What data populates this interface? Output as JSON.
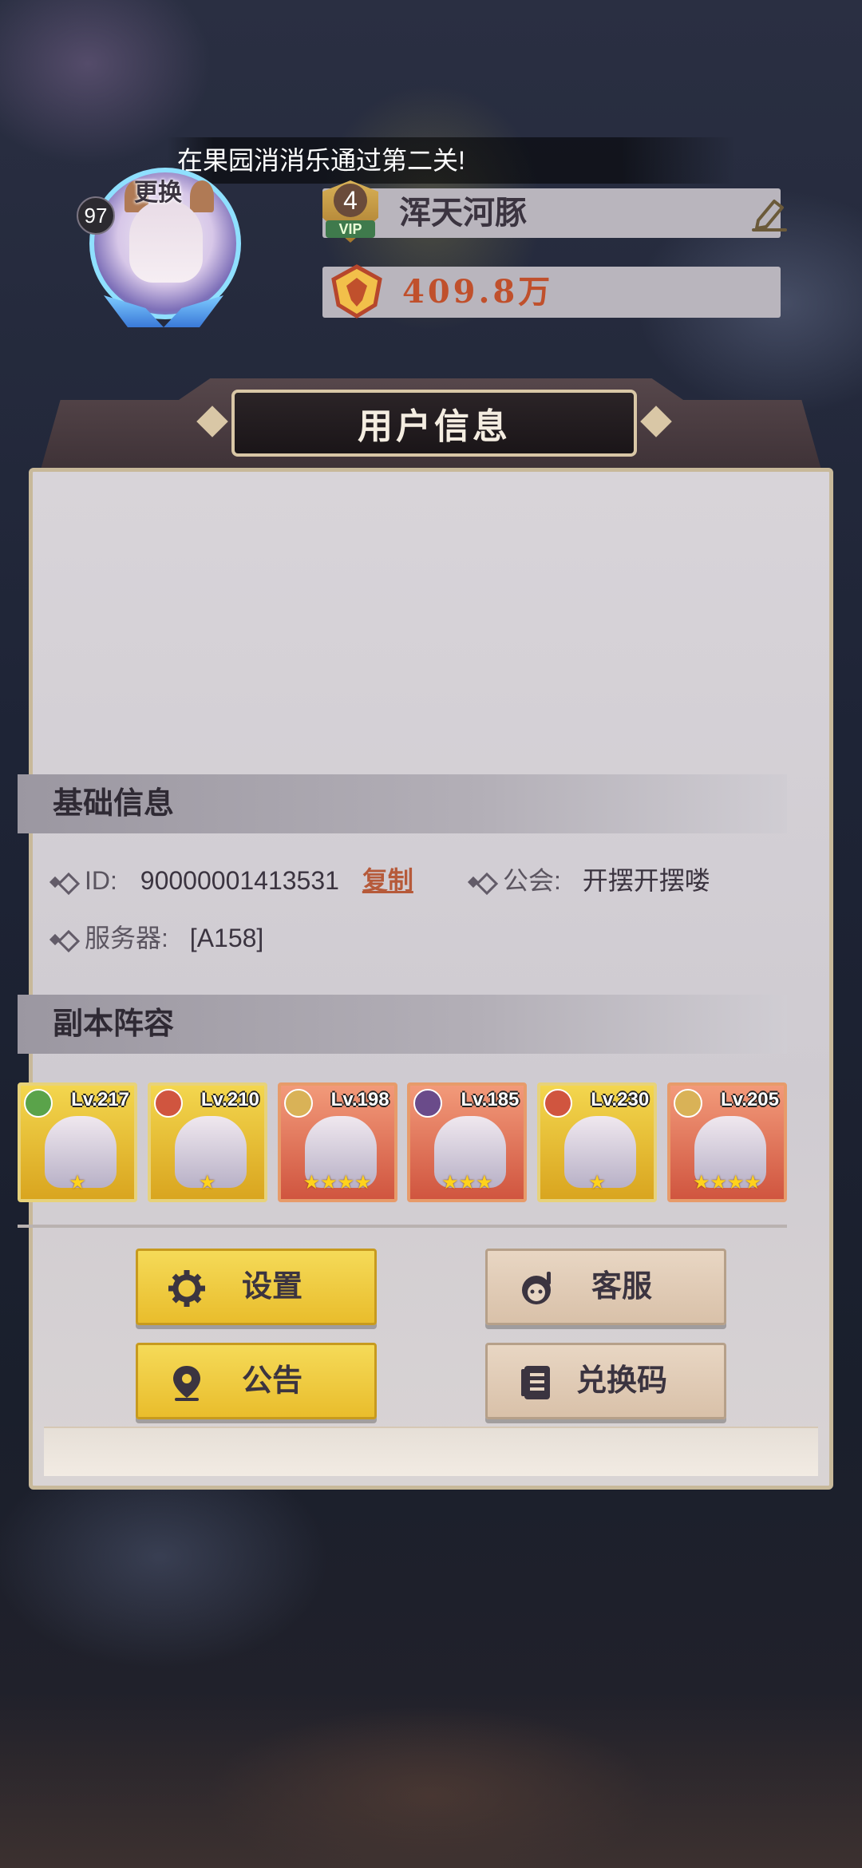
{
  "banner": {
    "text": "在果园消消乐通过第二关!"
  },
  "dialog": {
    "title": "用户信息",
    "avatar": {
      "level": "97",
      "change_label": "更换"
    },
    "vip": {
      "level": "4",
      "tag": "VIP"
    },
    "player_name": "浑天河豚",
    "power": "409.8万",
    "basic_info": {
      "section_title": "基础信息",
      "id_label": "ID:",
      "id_value": "90000001413531",
      "copy_label": "复制",
      "guild_label": "公会:",
      "guild_value": "开摆开摆喽",
      "server_label": "服务器:",
      "server_value": "[A158]"
    },
    "lineup": {
      "section_title": "副本阵容",
      "heroes": [
        {
          "level": "Lv.217",
          "stars": "★",
          "style": "gold",
          "element_color": "#5aa34a"
        },
        {
          "level": "Lv.210",
          "stars": "★",
          "style": "gold",
          "element_color": "#d0553f"
        },
        {
          "level": "Lv.198",
          "stars": "★★★★",
          "style": "red",
          "element_color": "#d9b257"
        },
        {
          "level": "Lv.185",
          "stars": "★★★",
          "style": "red",
          "element_color": "#6a4b8a"
        },
        {
          "level": "Lv.230",
          "stars": "★",
          "style": "gold",
          "element_color": "#d0553f"
        },
        {
          "level": "Lv.205",
          "stars": "★★★★",
          "style": "red",
          "element_color": "#d9b257"
        }
      ]
    },
    "buttons": {
      "settings": "设置",
      "support": "客服",
      "notice": "公告",
      "redeem": "兑换码"
    }
  },
  "colors": {
    "accent_yellow": "#f5da58",
    "accent_tan": "#e8d6c3",
    "power_red": "#c0502c"
  }
}
